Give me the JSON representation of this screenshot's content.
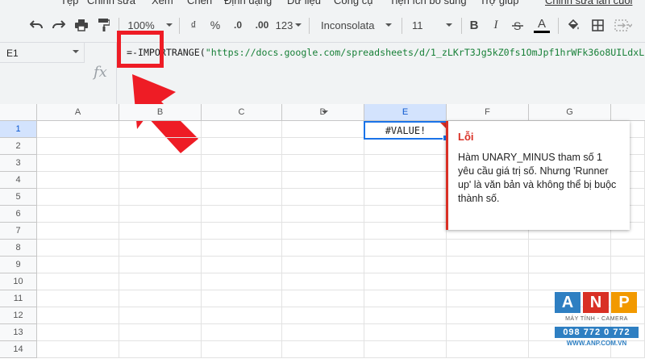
{
  "menu": [
    "Tệp",
    "Chỉnh sửa",
    "Xem",
    "Chèn",
    "Định dạng",
    "Dữ liệu",
    "Công cụ",
    "Tiện ích bổ sung",
    "Trợ giúp",
    "Chỉnh sửa lần cuối"
  ],
  "toolbar": {
    "zoom": "100%",
    "currency": "₫",
    "percent": "%",
    "decrease_decimal": ".0",
    "increase_decimal": ".00",
    "number_format": "123",
    "font": "Inconsolata",
    "font_size": "11",
    "bold": "B",
    "italic": "I",
    "text_color_letter": "A",
    "text_color": "#000000"
  },
  "formula_bar": {
    "cell_ref": "E1",
    "fx": "fx",
    "formula_prefix": "=-IMPORTRANGE(",
    "formula_string": "\"https://docs.google.com/spreadsheets/d/1_zLKrT3Jg5kZ0fs1OmJpf1hrWFk36o8UILdxL"
  },
  "columns": [
    "A",
    "B",
    "C",
    "D",
    "E",
    "F",
    "G"
  ],
  "rows": [
    "1",
    "2",
    "3",
    "4",
    "5",
    "6",
    "7",
    "8",
    "9",
    "10",
    "11",
    "12",
    "13",
    "14"
  ],
  "selected_column": "E",
  "selected_row": "1",
  "active_cell_value": "#VALUE!",
  "error_tooltip": {
    "title": "Lỗi",
    "message": "Hàm UNARY_MINUS tham số 1 yêu cầu giá trị số. Nhưng 'Runner up' là văn bản và không thể bị buộc thành số."
  },
  "watermark": {
    "letters": [
      "A",
      "N",
      "P"
    ],
    "tagline": "MÁY TÍNH - CAMERA",
    "phone": "098 772 0 772",
    "website": "WWW.ANP.COM.VN",
    "colors": [
      "#2e7fc2",
      "#d93025",
      "#f29900"
    ]
  },
  "colors": {
    "error": "#d93025",
    "selection": "#1a73e8",
    "annotation": "#ee1c25"
  }
}
